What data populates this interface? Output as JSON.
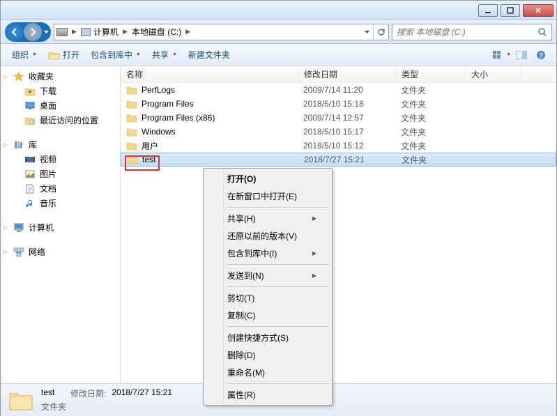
{
  "breadcrumb": {
    "computer": "计算机",
    "drive": "本地磁盘 (C:)"
  },
  "search": {
    "placeholder": "搜索 本地磁盘 (C:)"
  },
  "toolbar": {
    "organize": "组织",
    "open": "打开",
    "include": "包含到库中",
    "share": "共享",
    "new_folder": "新建文件夹"
  },
  "sidebar": {
    "favorites": "收藏夹",
    "downloads": "下载",
    "desktop": "桌面",
    "recent": "最近访问的位置",
    "libraries": "库",
    "videos": "视频",
    "pictures": "图片",
    "documents": "文档",
    "music": "音乐",
    "computer": "计算机",
    "network": "网络"
  },
  "columns": {
    "name": "名称",
    "date": "修改日期",
    "type": "类型",
    "size": "大小"
  },
  "files": [
    {
      "name": "PerfLogs",
      "date": "2009/7/14 11:20",
      "type": "文件夹"
    },
    {
      "name": "Program Files",
      "date": "2018/5/10 15:18",
      "type": "文件夹"
    },
    {
      "name": "Program Files (x86)",
      "date": "2009/7/14 12:57",
      "type": "文件夹"
    },
    {
      "name": "Windows",
      "date": "2018/5/10 15:17",
      "type": "文件夹"
    },
    {
      "name": "用户",
      "date": "2018/5/10 15:12",
      "type": "文件夹"
    },
    {
      "name": "test",
      "date": "2018/7/27 15:21",
      "type": "文件夹"
    }
  ],
  "context_menu": {
    "open": "打开(O)",
    "open_new": "在新窗口中打开(E)",
    "share": "共享(H)",
    "restore": "还原以前的版本(V)",
    "include": "包含到库中(I)",
    "send_to": "发送到(N)",
    "cut": "剪切(T)",
    "copy": "复制(C)",
    "shortcut": "创建快捷方式(S)",
    "delete": "删除(D)",
    "rename": "重命名(M)",
    "properties": "属性(R)"
  },
  "status": {
    "name": "test",
    "date_label": "修改日期:",
    "date": "2018/7/27 15:21",
    "type": "文件夹"
  }
}
